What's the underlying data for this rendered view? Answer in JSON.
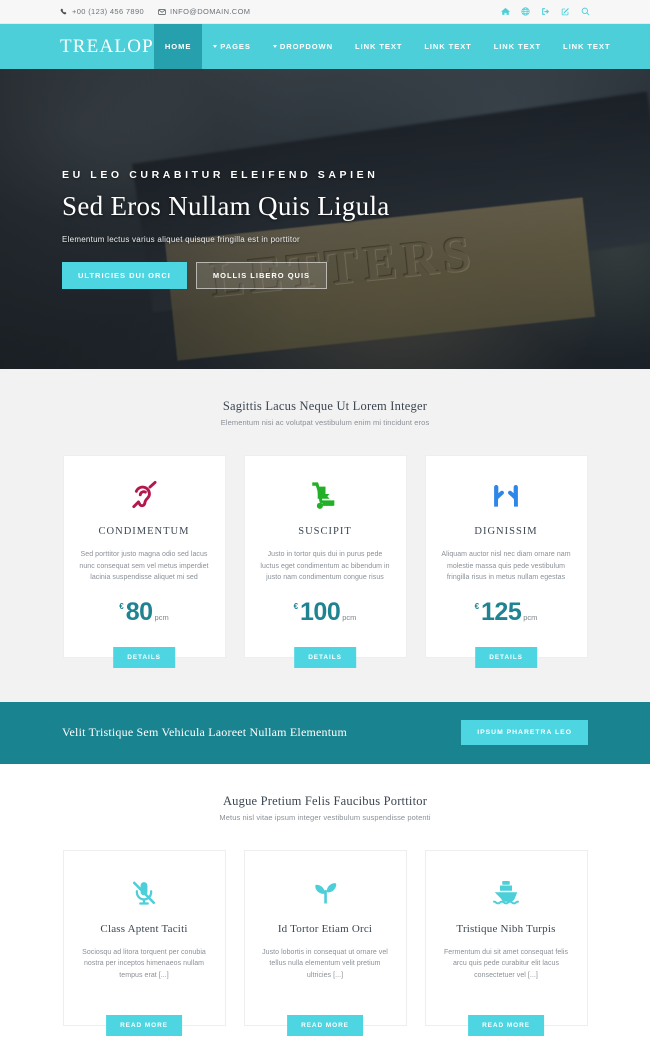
{
  "topbar": {
    "phone": "+00 (123) 456 7890",
    "email": "INFO@DOMAIN.COM",
    "phone_icon": "phone-icon",
    "email_icon": "envelope-icon",
    "icons": [
      "home-icon",
      "globe-icon",
      "sign-in-icon",
      "edit-icon",
      "search-icon"
    ]
  },
  "header": {
    "logo": "TREALOP",
    "nav": [
      {
        "label": "HOME",
        "active": true,
        "caret": false
      },
      {
        "label": "PAGES",
        "active": false,
        "caret": true
      },
      {
        "label": "DROPDOWN",
        "active": false,
        "caret": true
      },
      {
        "label": "LINK TEXT",
        "active": false,
        "caret": false
      },
      {
        "label": "LINK TEXT",
        "active": false,
        "caret": false
      },
      {
        "label": "LINK TEXT",
        "active": false,
        "caret": false
      },
      {
        "label": "LINK TEXT",
        "active": false,
        "caret": false
      }
    ]
  },
  "hero": {
    "kicker": "EU LEO CURABITUR ELEIFEND SAPIEN",
    "title": "Sed Eros Nullam Quis Ligula",
    "subtitle": "Elementum lectus varius aliquet quisque fringilla est in porttitor",
    "primary_button": "ULTRICIES DUI ORCI",
    "secondary_button": "MOLLIS LIBERO QUIS",
    "background_text": "LETTERS"
  },
  "pricing_section": {
    "title": "Sagittis Lacus Neque Ut Lorem Integer",
    "subtitle": "Elementum nisi ac volutpat vestibulum enim mi tincidunt eros",
    "cards": [
      {
        "icon": "deaf-ear-icon",
        "icon_color": "#b3184a",
        "title": "CONDIMENTUM",
        "text": "Sed porttitor justo magna odio sed lacus nunc consequat sem vel metus imperdiet lacinia suspendisse aliquet mi sed",
        "currency": "€",
        "price": "80",
        "period": "pcm",
        "button": "DETAILS"
      },
      {
        "icon": "dolly-icon",
        "icon_color": "#22b028",
        "title": "SUSCIPIT",
        "text": "Justo in tortor quis dui in purus pede luctus eget condimentum ac bibendum in justo nam condimentum congue risus",
        "currency": "€",
        "price": "100",
        "period": "pcm",
        "button": "DETAILS"
      },
      {
        "icon": "open-hands-icon",
        "icon_color": "#2d86e8",
        "title": "DIGNISSIM",
        "text": "Aliquam auctor nisl nec diam ornare nam molestie massa quis pede vestibulum fringilla risus in metus nullam egestas",
        "currency": "€",
        "price": "125",
        "period": "pcm",
        "button": "DETAILS"
      }
    ]
  },
  "cta": {
    "text": "Velit Tristique Sem Vehicula Laoreet Nullam Elementum",
    "button": "IPSUM PHARETRA LEO"
  },
  "features_section": {
    "title": "Augue Pretium Felis Faucibus Porttitor",
    "subtitle": "Metus nisl vitae ipsum integer vestibulum suspendisse potenti",
    "cards": [
      {
        "icon": "microphone-slash-icon",
        "icon_color": "#4ccfd9",
        "title": "Class Aptent Taciti",
        "text": "Sociosqu ad litora torquent per conubia nostra per inceptos himenaeos nullam tempus erat [...]",
        "button": "READ MORE"
      },
      {
        "icon": "seedling-icon",
        "icon_color": "#4ccfd9",
        "title": "Id Tortor Etiam Orci",
        "text": "Justo lobortis in consequat ut ornare vel tellus nulla elementum velit pretium ultricies [...]",
        "button": "READ MORE"
      },
      {
        "icon": "ship-icon",
        "icon_color": "#4ccfd9",
        "title": "Tristique Nibh Turpis",
        "text": "Fermentum dui sit amet consequat felis arcu quis pede curabitur elit lacus consectetuer vel [...]",
        "button": "READ MORE"
      }
    ]
  },
  "colors": {
    "brand_turquoise": "#4ccfd9",
    "brand_teal_dark": "#1a8390",
    "nav_active": "#27a0ad",
    "button_cyan": "#4dd6e2",
    "price_teal": "#1f8391",
    "section_grey": "#f2f2f2"
  }
}
